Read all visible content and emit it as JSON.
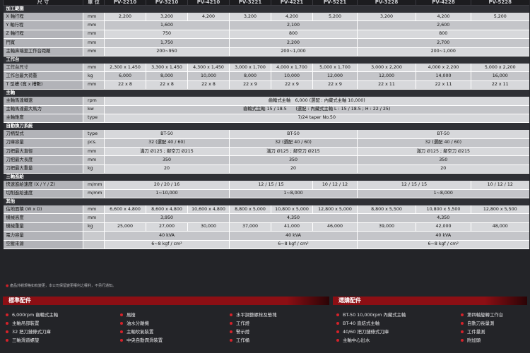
{
  "header": [
    "尺 寸",
    "單 位",
    "PV-2210",
    "PV-3210",
    "PV-4210",
    "PV-3221",
    "PV-4221",
    "PV-5221",
    "PV-3228",
    "PV-4228",
    "PV-5228"
  ],
  "sections": [
    {
      "title": "加工範圍",
      "rows": [
        {
          "label": "X 軸行程",
          "unit": "mm",
          "cells": [
            {
              "t": "2,200",
              "s": 1
            },
            {
              "t": "3,200",
              "s": 1
            },
            {
              "t": "4,200",
              "s": 1
            },
            {
              "t": "3,200",
              "s": 1
            },
            {
              "t": "4,200",
              "s": 1
            },
            {
              "t": "5,200",
              "s": 1
            },
            {
              "t": "3,200",
              "s": 1
            },
            {
              "t": "4,200",
              "s": 1
            },
            {
              "t": "5,200",
              "s": 1
            }
          ]
        },
        {
          "label": "Y 軸行程",
          "unit": "mm",
          "cells": [
            {
              "t": "1,600",
              "s": 3
            },
            {
              "t": "2,100",
              "s": 3
            },
            {
              "t": "2,600",
              "s": 3
            }
          ]
        },
        {
          "label": "Z 軸行程",
          "unit": "mm",
          "cells": [
            {
              "t": "750",
              "s": 3
            },
            {
              "t": "800",
              "s": 3
            },
            {
              "t": "800",
              "s": 3
            }
          ]
        },
        {
          "label": "門寬",
          "unit": "mm",
          "cells": [
            {
              "t": "1,750",
              "s": 3
            },
            {
              "t": "2,200",
              "s": 3
            },
            {
              "t": "2,700",
              "s": 3
            }
          ]
        },
        {
          "label": "主軸鼻端至工作台距離",
          "unit": "mm",
          "cells": [
            {
              "t": "200~950",
              "s": 3
            },
            {
              "t": "200~1,000",
              "s": 3
            },
            {
              "t": "200~1,000",
              "s": 3
            }
          ]
        }
      ]
    },
    {
      "title": "工作台",
      "rows": [
        {
          "label": "工作台尺寸",
          "unit": "mm",
          "cells": [
            {
              "t": "2,300 x 1,450",
              "s": 1
            },
            {
              "t": "3,300 x 1,450",
              "s": 1
            },
            {
              "t": "4,300 x 1,450",
              "s": 1
            },
            {
              "t": "3,000 x 1,700",
              "s": 1
            },
            {
              "t": "4,000 x 1,700",
              "s": 1
            },
            {
              "t": "5,000 x 1,700",
              "s": 1
            },
            {
              "t": "3,000 x 2,200",
              "s": 1
            },
            {
              "t": "4,000 x 2,200",
              "s": 1
            },
            {
              "t": "5,000 x 2,200",
              "s": 1
            }
          ]
        },
        {
          "label": "工作台最大荷重",
          "unit": "kg",
          "cells": [
            {
              "t": "6,000",
              "s": 1
            },
            {
              "t": "8,000",
              "s": 1
            },
            {
              "t": "10,000",
              "s": 1
            },
            {
              "t": "8,000",
              "s": 1
            },
            {
              "t": "10,000",
              "s": 1
            },
            {
              "t": "12,000",
              "s": 1
            },
            {
              "t": "12,000",
              "s": 1
            },
            {
              "t": "14,000",
              "s": 1
            },
            {
              "t": "16,000",
              "s": 1
            }
          ]
        },
        {
          "label": "T 型槽 (寬 x 槽數)",
          "unit": "mm",
          "cells": [
            {
              "t": "22 x 8",
              "s": 1
            },
            {
              "t": "22 x 8",
              "s": 1
            },
            {
              "t": "22 x 8",
              "s": 1
            },
            {
              "t": "22 x 9",
              "s": 1
            },
            {
              "t": "22 x 9",
              "s": 1
            },
            {
              "t": "22 x 9",
              "s": 1
            },
            {
              "t": "22 x 11",
              "s": 1
            },
            {
              "t": "22 x 11",
              "s": 1
            },
            {
              "t": "22 x 11",
              "s": 1
            }
          ]
        }
      ]
    },
    {
      "title": "主軸",
      "rows": [
        {
          "label": "主軸馬達轉速",
          "unit": "rpm",
          "cells": [
            {
              "t": "齒輪式主軸　6,000 (選配 : 內藏式主軸 10,000)",
              "s": 9
            }
          ]
        },
        {
          "label": "主軸馬達最大馬力",
          "unit": "kw",
          "cells": [
            {
              "t": "齒輪式主軸 15 / 18.5　　(選配 : 內藏式主軸 L : 15 / 18.5 ; H : 22 / 25)",
              "s": 9
            }
          ]
        },
        {
          "label": "主軸錐度",
          "unit": "type",
          "cells": [
            {
              "t": "7/24 taper No.50",
              "s": 9
            }
          ]
        }
      ]
    },
    {
      "title": "自動換刀系統",
      "rows": [
        {
          "label": "刀柄型式",
          "unit": "type",
          "cells": [
            {
              "t": "BT-50",
              "s": 3
            },
            {
              "t": "BT-50",
              "s": 3
            },
            {
              "t": "BT-50",
              "s": 3
            }
          ]
        },
        {
          "label": "刀庫容量",
          "unit": "pcs.",
          "cells": [
            {
              "t": "32 (選配 40 / 60)",
              "s": 3
            },
            {
              "t": "32 (選配 40 / 60)",
              "s": 3
            },
            {
              "t": "32 (選配 40 / 60)",
              "s": 3
            }
          ]
        },
        {
          "label": "刀把最大直徑",
          "unit": "mm",
          "cells": [
            {
              "t": "滿刀 Ø125 ; 鄰空刀 Ø215",
              "s": 3
            },
            {
              "t": "滿刀 Ø125 ; 鄰空刀 Ø215",
              "s": 3
            },
            {
              "t": "滿刀 Ø125 ; 鄰空刀 Ø215",
              "s": 3
            }
          ]
        },
        {
          "label": "刀把最大長度",
          "unit": "mm",
          "cells": [
            {
              "t": "350",
              "s": 3
            },
            {
              "t": "350",
              "s": 3
            },
            {
              "t": "350",
              "s": 3
            }
          ]
        },
        {
          "label": "刀把最大重量",
          "unit": "kg",
          "cells": [
            {
              "t": "20",
              "s": 3
            },
            {
              "t": "20",
              "s": 3
            },
            {
              "t": "20",
              "s": 3
            }
          ]
        }
      ]
    },
    {
      "title": "三軸進給",
      "rows": [
        {
          "label": "快速進給速度 (X / Y / Z)",
          "unit": "m/mm",
          "cells": [
            {
              "t": "20 / 20 / 16",
              "s": 3
            },
            {
              "t": "12 / 15 / 15",
              "s": 2
            },
            {
              "t": "10 / 12 / 12",
              "s": 1
            },
            {
              "t": "12 / 15 / 15",
              "s": 2
            },
            {
              "t": "10 / 12 / 12",
              "s": 1
            }
          ]
        },
        {
          "label": "切削進給速度",
          "unit": "m/mm",
          "cells": [
            {
              "t": "1~10,000",
              "s": 3
            },
            {
              "t": "1~8,000",
              "s": 3
            },
            {
              "t": "1~8,000",
              "s": 3
            }
          ]
        }
      ]
    },
    {
      "title": "其他",
      "rows": [
        {
          "label": "佔地面積 (W x D)",
          "unit": "mm",
          "cells": [
            {
              "t": "6,600 x 4,800",
              "s": 1
            },
            {
              "t": "8,600 x 4,800",
              "s": 1
            },
            {
              "t": "10,600 x 4,800",
              "s": 1
            },
            {
              "t": "8,800 x 5,000",
              "s": 1
            },
            {
              "t": "10,800 x 5,000",
              "s": 1
            },
            {
              "t": "12,800 x 5,000",
              "s": 1
            },
            {
              "t": "8,800 x 5,500",
              "s": 1
            },
            {
              "t": "10,800 x 5,500",
              "s": 1
            },
            {
              "t": "12,800 x 5,500",
              "s": 1
            }
          ]
        },
        {
          "label": "機械高度",
          "unit": "mm",
          "cells": [
            {
              "t": "3,950",
              "s": 3
            },
            {
              "t": "4,350",
              "s": 3
            },
            {
              "t": "4,350",
              "s": 3
            }
          ]
        },
        {
          "label": "機械重量",
          "unit": "kg",
          "cells": [
            {
              "t": "25,000",
              "s": 1
            },
            {
              "t": "27,000",
              "s": 1
            },
            {
              "t": "30,000",
              "s": 1
            },
            {
              "t": "37,000",
              "s": 1
            },
            {
              "t": "41,000",
              "s": 1
            },
            {
              "t": "46,000",
              "s": 1
            },
            {
              "t": "39,000",
              "s": 1
            },
            {
              "t": "42,000",
              "s": 1
            },
            {
              "t": "48,000",
              "s": 1
            }
          ]
        },
        {
          "label": "電力容量",
          "unit": "",
          "cells": [
            {
              "t": "40 kVA",
              "s": 3
            },
            {
              "t": "40 kVA",
              "s": 3
            },
            {
              "t": "40 kVA",
              "s": 3
            }
          ]
        },
        {
          "label": "空壓來源",
          "unit": "",
          "cells": [
            {
              "t": "6~8 kgf / cm²",
              "s": 3
            },
            {
              "t": "6~8 kgf / cm²",
              "s": 3
            },
            {
              "t": "6~8 kgf / cm²",
              "s": 3
            }
          ]
        }
      ]
    }
  ],
  "footnote": "產品外觀規格如有變更，本公司保留變更權利之權利，不另行通知。",
  "standard": {
    "title": "標準配件",
    "columns": [
      [
        "6,000rpm 齒輪式主軸",
        "主軸吊部裝置",
        "32 把刀鏈條式刀庫",
        "三軸滑道螺旋"
      ],
      [
        "風槍",
        "油水分離機",
        "主軸吹氣裝置",
        "中央自動潤滑裝置"
      ],
      [
        "水平調整螺栓及墊塊",
        "工作燈",
        "警示燈",
        "工作桶"
      ]
    ]
  },
  "optional": {
    "title": "選購配件",
    "columns": [
      [
        "BT-50 10,000rpm 內藏式主軸",
        "BT-40 直結式主軸",
        "40/60 把刀鏈條式刀庫",
        "主軸中心出水"
      ],
      [
        "第四軸旋轉工作台",
        "自動刀長量測",
        "工件量測",
        "附加頭"
      ]
    ]
  }
}
